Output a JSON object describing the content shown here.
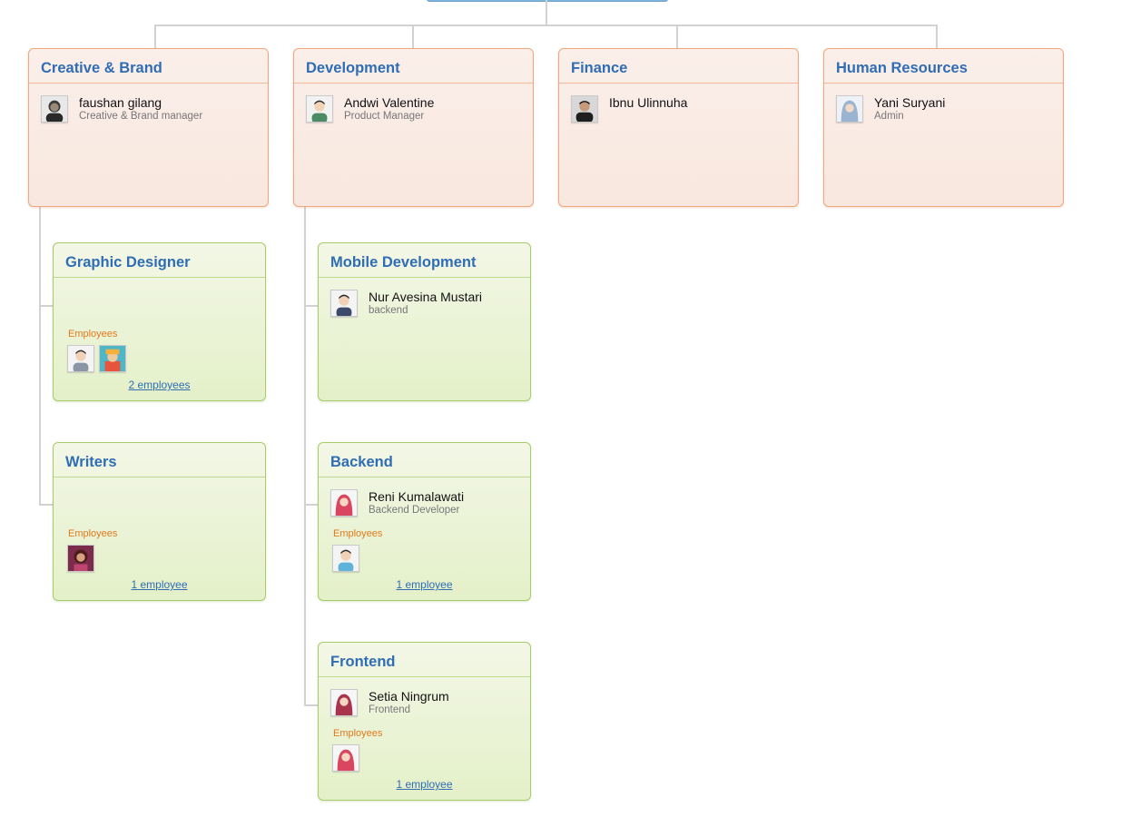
{
  "departments": [
    {
      "title": "Creative & Brand",
      "manager": {
        "name": "faushan gilang",
        "role": "Creative & Brand manager",
        "avatar": "male-portrait-dark-icon"
      }
    },
    {
      "title": "Development",
      "manager": {
        "name": "Andwi Valentine",
        "role": "Product Manager",
        "avatar": "male-avatar-green-icon"
      }
    },
    {
      "title": "Finance",
      "manager": {
        "name": "Ibnu Ulinnuha",
        "role": "",
        "avatar": "male-photo-dark-icon"
      }
    },
    {
      "title": "Human Resources",
      "manager": {
        "name": "Yani Suryani",
        "role": "Admin",
        "avatar": "female-hijab-blue-icon"
      }
    }
  ],
  "teams": [
    {
      "title": "Graphic Designer",
      "employees_label": "Employees",
      "employee_avatars": [
        "male-avatar-icon",
        "costume-avatar-icon"
      ],
      "employees_link": "2 employees"
    },
    {
      "title": "Writers",
      "employees_label": "Employees",
      "employee_avatars": [
        "female-photo-icon"
      ],
      "employees_link": "1 employee"
    },
    {
      "title": "Mobile Development",
      "lead": {
        "name": "Nur Avesina Mustari",
        "role": "backend",
        "avatar": "male-avatar-navy-icon"
      }
    },
    {
      "title": "Backend",
      "lead": {
        "name": "Reni Kumalawati",
        "role": "Backend Developer",
        "avatar": "female-hijab-red-icon"
      },
      "employees_label": "Employees",
      "employee_avatars": [
        "male-avatar-blue-shirt-icon"
      ],
      "employees_link": "1 employee"
    },
    {
      "title": "Frontend",
      "lead": {
        "name": "Setia Ningrum",
        "role": "Frontend",
        "avatar": "female-hijab-maroon-icon"
      },
      "employees_label": "Employees",
      "employee_avatars": [
        "female-hijab-red-icon"
      ],
      "employees_link": "1 employee"
    }
  ],
  "colors": {
    "title": "#2f6db4",
    "dept_border": "#f0a77c",
    "team_border": "#a7cc6a",
    "employees_label": "#e07a1c",
    "connector": "#d2d2d2"
  }
}
